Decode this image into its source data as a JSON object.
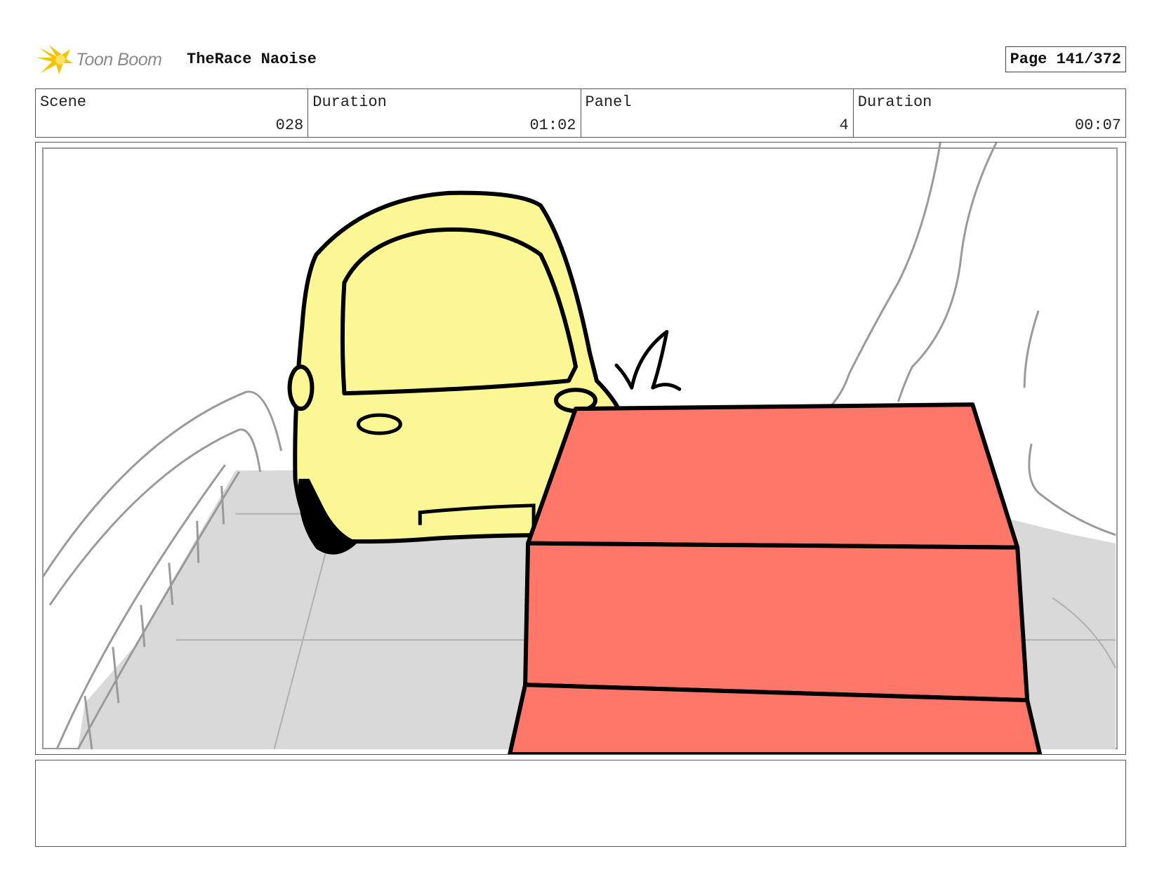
{
  "header": {
    "logo_text": "Toon Boom",
    "project_title": "TheRace Naoise",
    "page_label": "Page 141/372"
  },
  "info": {
    "scene_label": "Scene",
    "scene_value": "028",
    "scene_duration_label": "Duration",
    "scene_duration_value": "01:02",
    "panel_label": "Panel",
    "panel_value": "4",
    "panel_duration_label": "Duration",
    "panel_duration_value": "00:07"
  },
  "colors": {
    "car_fill": "#fbf795",
    "box_fill": "#ff7769",
    "ground_fill": "#d9d9d9",
    "logo_accent": "#f5c400"
  },
  "notes": {
    "text": ""
  }
}
